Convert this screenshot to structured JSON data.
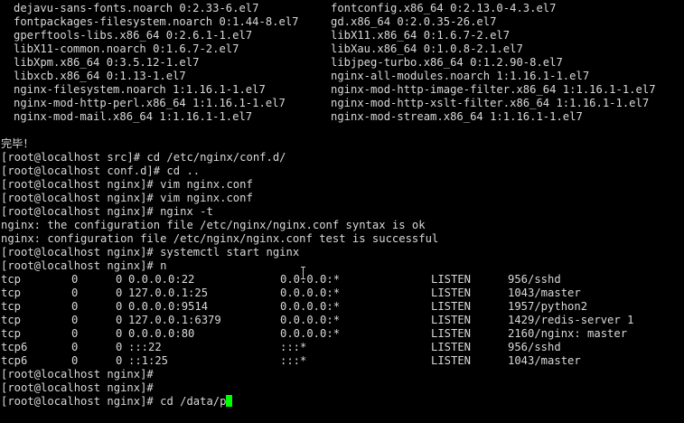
{
  "terminal": {
    "packages": [
      {
        "left": "dejavu-sans-fonts.noarch 0:2.33-6.el7",
        "right": "fontconfig.x86_64 0:2.13.0-4.3.el7"
      },
      {
        "left": "fontpackages-filesystem.noarch 0:1.44-8.el7",
        "right": "gd.x86_64 0:2.0.35-26.el7"
      },
      {
        "left": "gperftools-libs.x86_64 0:2.6.1-1.el7",
        "right": "libX11.x86_64 0:1.6.7-2.el7"
      },
      {
        "left": "libX11-common.noarch 0:1.6.7-2.el7",
        "right": "libXau.x86_64 0:1.0.8-2.1.el7"
      },
      {
        "left": "libXpm.x86_64 0:3.5.12-1.el7",
        "right": "libjpeg-turbo.x86_64 0:1.2.90-8.el7"
      },
      {
        "left": "libxcb.x86_64 0:1.13-1.el7",
        "right": "nginx-all-modules.noarch 1:1.16.1-1.el7"
      },
      {
        "left": "nginx-filesystem.noarch 1:1.16.1-1.el7",
        "right": "nginx-mod-http-image-filter.x86_64 1:1.16.1-1.el7"
      },
      {
        "left": "nginx-mod-http-perl.x86_64 1:1.16.1-1.el7",
        "right": "nginx-mod-http-xslt-filter.x86_64 1:1.16.1-1.el7"
      },
      {
        "left": "nginx-mod-mail.x86_64 1:1.16.1-1.el7",
        "right": "nginx-mod-stream.x86_64 1:1.16.1-1.el7"
      }
    ],
    "lines_before_netstat": [
      "完毕！",
      "[root@localhost src]# cd /etc/nginx/conf.d/",
      "[root@localhost conf.d]# cd ..",
      "[root@localhost nginx]# vim nginx.conf",
      "[root@localhost nginx]# vim nginx.conf",
      "[root@localhost nginx]# nginx -t",
      "nginx: the configuration file /etc/nginx/nginx.conf syntax is ok",
      "nginx: configuration file /etc/nginx/nginx.conf test is successful",
      "[root@localhost nginx]# systemctl start nginx",
      "[root@localhost nginx]# n"
    ],
    "netstat_rows": [
      {
        "proto": "tcp",
        "recvq": "0",
        "sendq": "0",
        "local": "0.0.0.0:22",
        "foreign": "0.0.0.0:*",
        "state": "LISTEN",
        "pid": "956/sshd"
      },
      {
        "proto": "tcp",
        "recvq": "0",
        "sendq": "0",
        "local": "127.0.0.1:25",
        "foreign": "0.0.0.0:*",
        "state": "LISTEN",
        "pid": "1043/master"
      },
      {
        "proto": "tcp",
        "recvq": "0",
        "sendq": "0",
        "local": "0.0.0.0:9514",
        "foreign": "0.0.0.0:*",
        "state": "LISTEN",
        "pid": "1957/python2"
      },
      {
        "proto": "tcp",
        "recvq": "0",
        "sendq": "0",
        "local": "127.0.0.1:6379",
        "foreign": "0.0.0.0:*",
        "state": "LISTEN",
        "pid": "1429/redis-server 1"
      },
      {
        "proto": "tcp",
        "recvq": "0",
        "sendq": "0",
        "local": "0.0.0.0:80",
        "foreign": "0.0.0.0:*",
        "state": "LISTEN",
        "pid": "2160/nginx: master"
      },
      {
        "proto": "tcp6",
        "recvq": "0",
        "sendq": "0",
        "local": ":::22",
        "foreign": ":::*",
        "state": "LISTEN",
        "pid": "956/sshd"
      },
      {
        "proto": "tcp6",
        "recvq": "0",
        "sendq": "0",
        "local": "::1:25",
        "foreign": ":::*",
        "state": "LISTEN",
        "pid": "1043/master"
      }
    ],
    "lines_after_netstat": [
      "[root@localhost nginx]#",
      "[root@localhost nginx]#"
    ],
    "prompt": "[root@localhost nginx]# ",
    "current_input": "cd /data/p",
    "colors": {
      "background": "#000000",
      "text": "#d9d9d9",
      "cursor": "#00ff00"
    }
  }
}
